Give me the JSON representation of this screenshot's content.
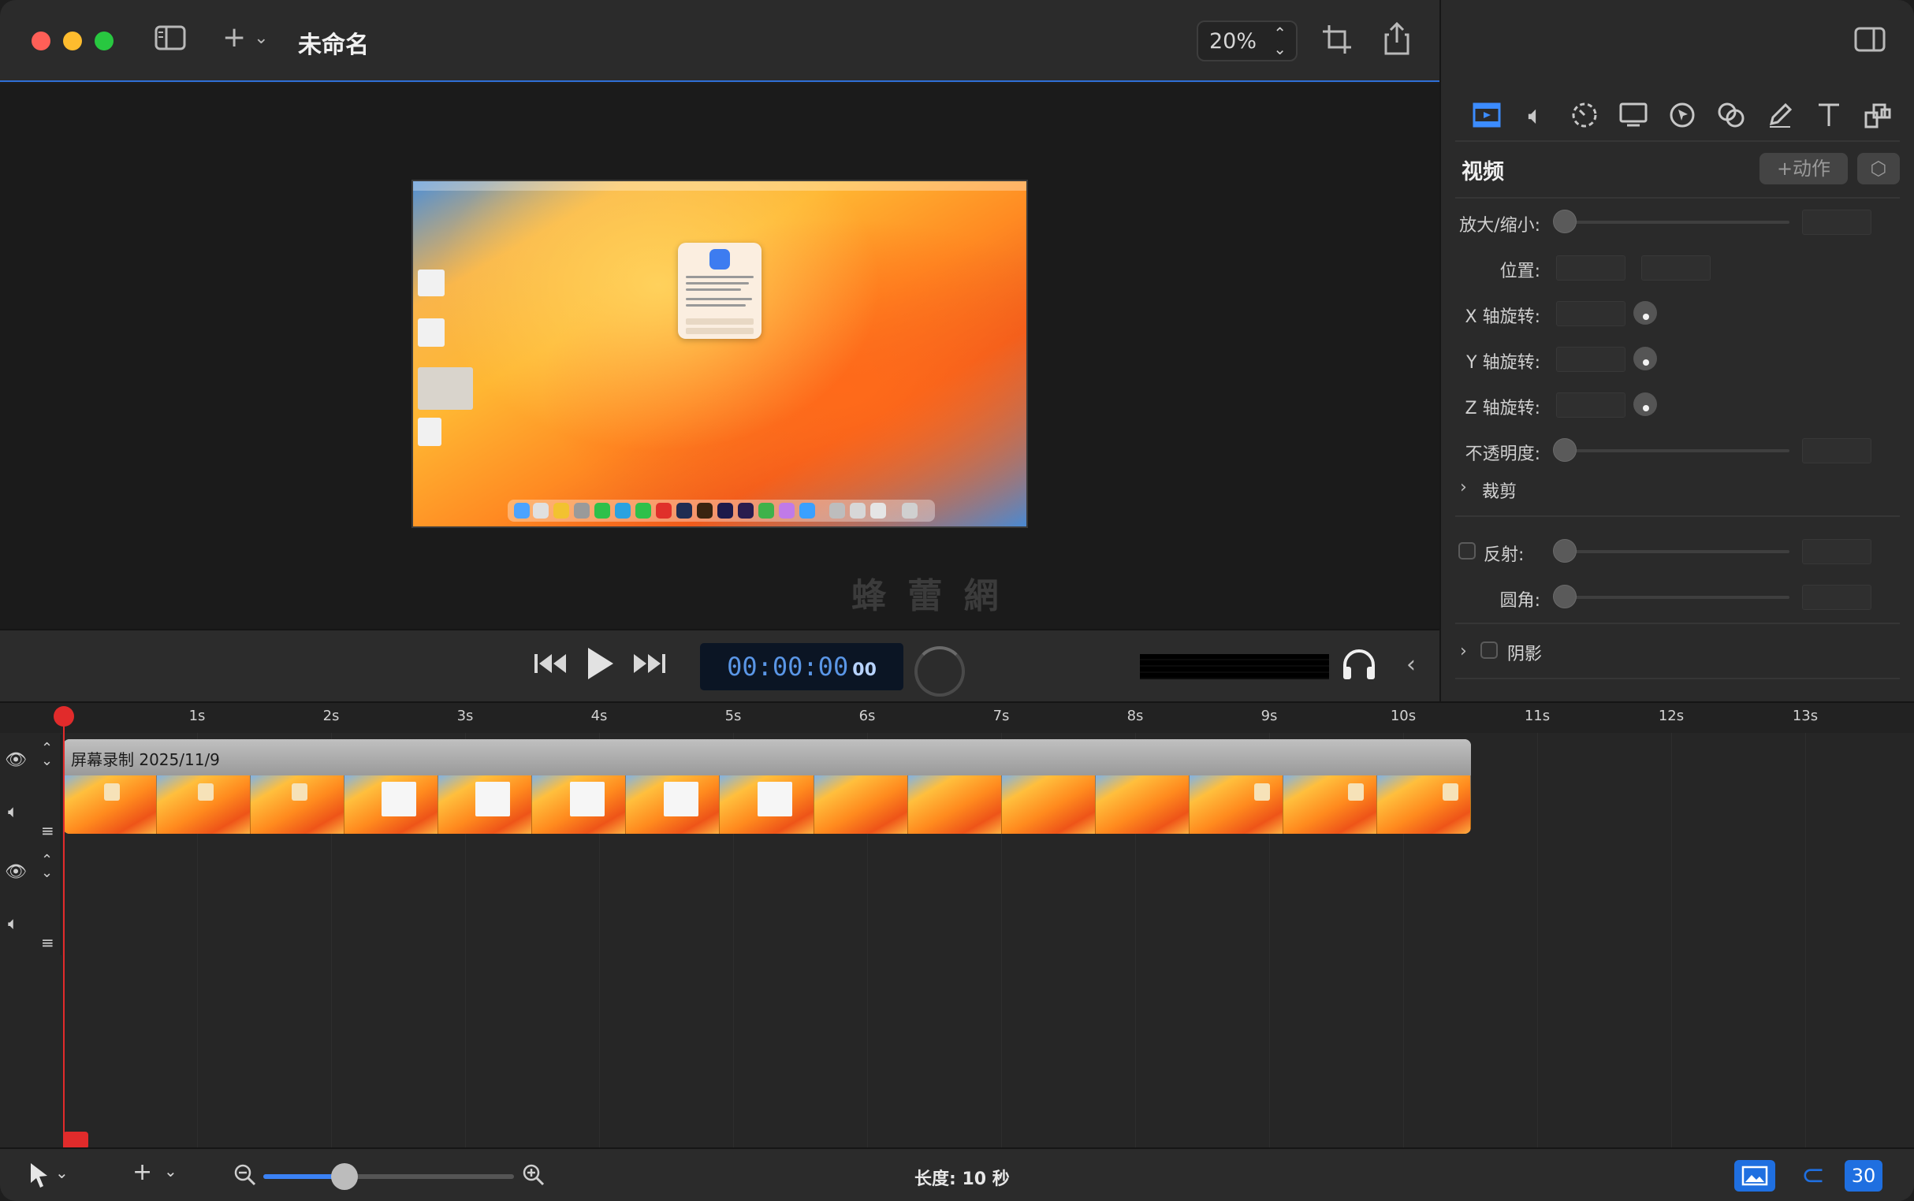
{
  "window": {
    "title": "未命名",
    "zoom_level": "20%",
    "traffic_lights": [
      "#ff5f57",
      "#febc2e",
      "#28c840"
    ],
    "accent_color": "#3c8cff"
  },
  "toolbar": {
    "icons": [
      "sidebar-toggle-icon",
      "plus-icon",
      "chevron-down-icon",
      "stepper-icon",
      "crop-icon",
      "share-icon",
      "inspector-toggle-icon"
    ]
  },
  "inspector": {
    "tabs": [
      "video-icon",
      "audio-icon",
      "speed-icon",
      "screen-icon",
      "cursor-icon",
      "effects-icon",
      "annotation-icon",
      "text-icon",
      "layout-icon"
    ],
    "heading": "视频",
    "action_button": "+动作",
    "properties": {
      "scale": "放大/缩小:",
      "position": "位置:",
      "x_rotation": "X 轴旋转:",
      "y_rotation": "Y 轴旋转:",
      "z_rotation": "Z 轴旋转:",
      "opacity": "不透明度:",
      "crop": "裁剪",
      "reflection": "反射:",
      "corner_radius": "圆角:",
      "shadow": "阴影"
    }
  },
  "transport": {
    "timecode": "00:00:00",
    "frames": "00"
  },
  "timeline": {
    "ruler": [
      "1s",
      "2s",
      "3s",
      "4s",
      "5s",
      "6s",
      "7s",
      "8s",
      "9s",
      "10s",
      "11s",
      "12s",
      "13s"
    ],
    "clip_title": "屏幕录制 2025/11/9",
    "frame_count": 15
  },
  "bottom": {
    "length_label": "长度: 10 秒",
    "fps_badge": "30",
    "timeline_zoom": 0.35
  },
  "watermark": "蜂 蕾 網"
}
